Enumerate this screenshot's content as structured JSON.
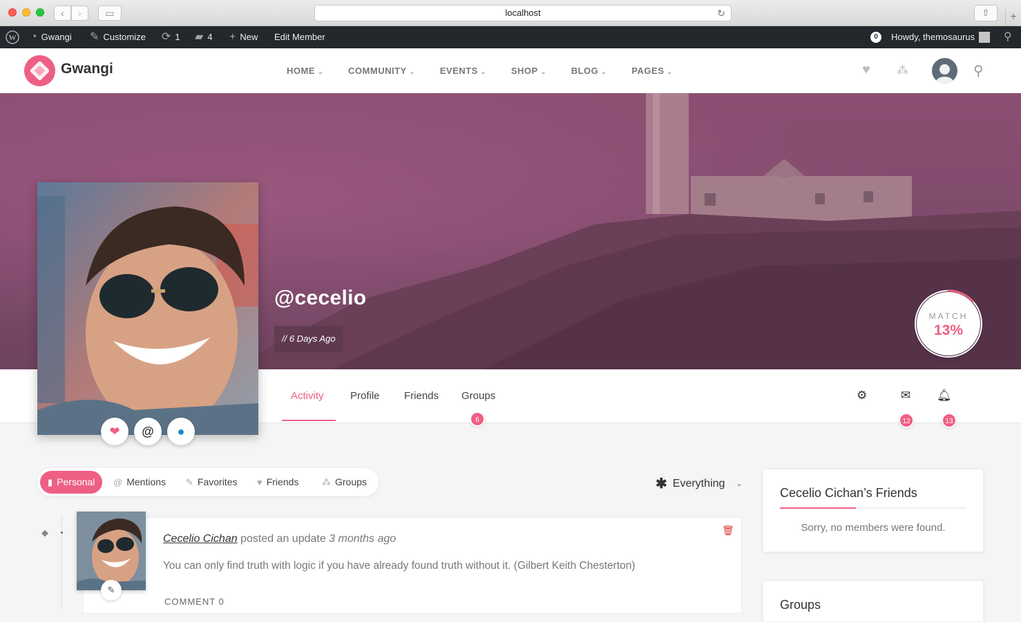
{
  "browser": {
    "url": "localhost"
  },
  "adminbar": {
    "site_name": "Gwangi",
    "customize": "Customize",
    "updates_count": "1",
    "comments_count": "4",
    "new_label": "New",
    "edit_member": "Edit Member",
    "notif_count": "0",
    "howdy": "Howdy, themosaurus"
  },
  "header": {
    "logo_text": "Gwangi",
    "nav": [
      {
        "label": "HOME"
      },
      {
        "label": "COMMUNITY"
      },
      {
        "label": "EVENTS"
      },
      {
        "label": "SHOP"
      },
      {
        "label": "BLOG"
      },
      {
        "label": "PAGES"
      }
    ]
  },
  "profile": {
    "username": "@cecelio",
    "last_active": "// 6 Days Ago",
    "match_label": "MATCH",
    "match_value": "13%",
    "match_fraction": 0.13,
    "tabs": [
      {
        "label": "Activity"
      },
      {
        "label": "Profile"
      },
      {
        "label": "Friends"
      },
      {
        "label": "Groups"
      }
    ],
    "groups_count": "6",
    "messages_count": "12",
    "notifications_count": "13"
  },
  "activity": {
    "filters": [
      {
        "label": "Personal"
      },
      {
        "label": "Mentions"
      },
      {
        "label": "Favorites"
      },
      {
        "label": "Friends"
      },
      {
        "label": "Groups"
      }
    ],
    "show_filter": "Everything",
    "item": {
      "author": "Cecelio Cichan",
      "action": "posted an update",
      "when": "3 months ago",
      "content": "You can only find truth with logic if you have already found truth without it. (Gilbert Keith Chesterton)",
      "comment_label": "COMMENT 0"
    }
  },
  "sidebar": {
    "friends_title": "Cecelio Cichan’s Friends",
    "friends_empty": "Sorry, no members were found.",
    "groups_title": "Groups"
  },
  "colors": {
    "accent": "#ee5f84",
    "adminbar": "#23282d"
  }
}
